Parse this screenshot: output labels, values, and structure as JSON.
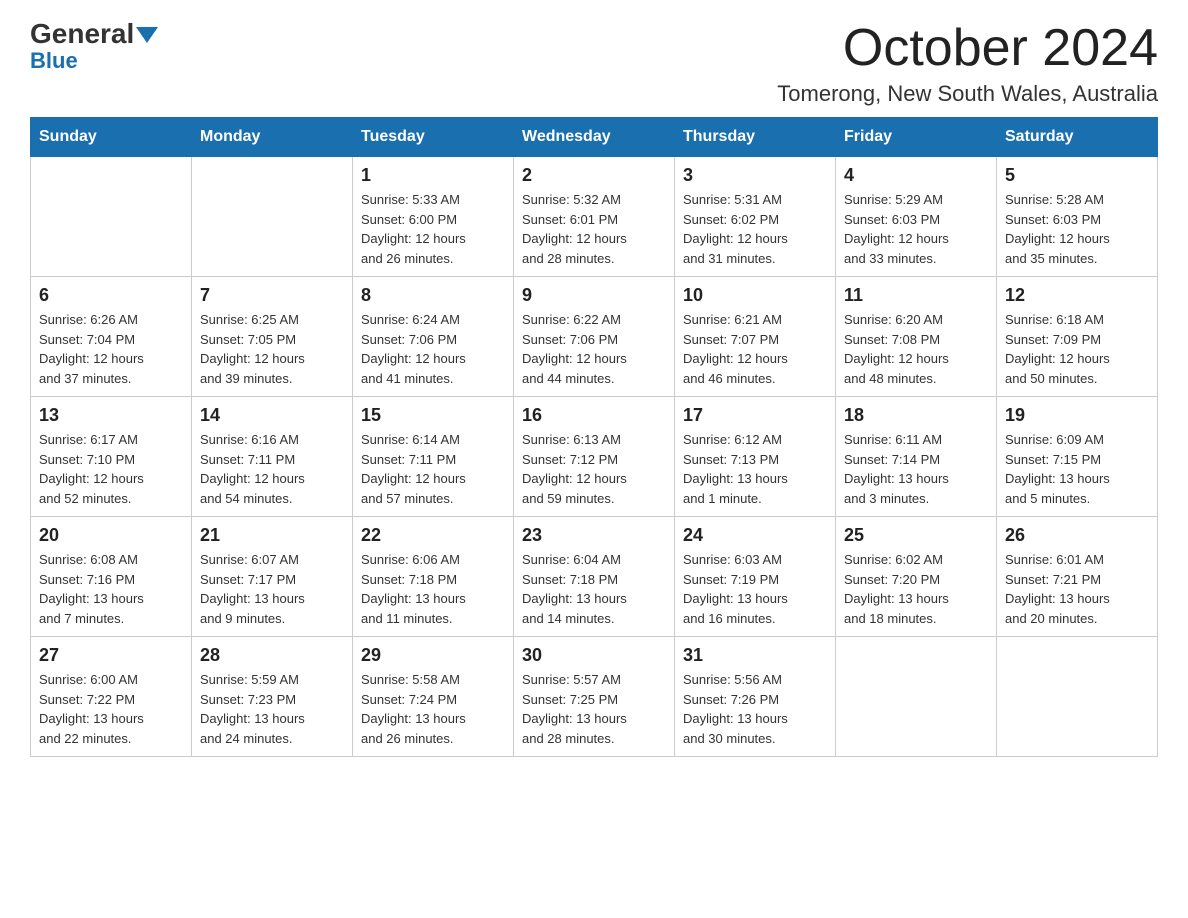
{
  "header": {
    "logo_general": "General",
    "logo_blue": "Blue",
    "title": "October 2024",
    "subtitle": "Tomerong, New South Wales, Australia"
  },
  "calendar": {
    "days_of_week": [
      "Sunday",
      "Monday",
      "Tuesday",
      "Wednesday",
      "Thursday",
      "Friday",
      "Saturday"
    ],
    "weeks": [
      [
        {
          "day": "",
          "info": ""
        },
        {
          "day": "",
          "info": ""
        },
        {
          "day": "1",
          "info": "Sunrise: 5:33 AM\nSunset: 6:00 PM\nDaylight: 12 hours\nand 26 minutes."
        },
        {
          "day": "2",
          "info": "Sunrise: 5:32 AM\nSunset: 6:01 PM\nDaylight: 12 hours\nand 28 minutes."
        },
        {
          "day": "3",
          "info": "Sunrise: 5:31 AM\nSunset: 6:02 PM\nDaylight: 12 hours\nand 31 minutes."
        },
        {
          "day": "4",
          "info": "Sunrise: 5:29 AM\nSunset: 6:03 PM\nDaylight: 12 hours\nand 33 minutes."
        },
        {
          "day": "5",
          "info": "Sunrise: 5:28 AM\nSunset: 6:03 PM\nDaylight: 12 hours\nand 35 minutes."
        }
      ],
      [
        {
          "day": "6",
          "info": "Sunrise: 6:26 AM\nSunset: 7:04 PM\nDaylight: 12 hours\nand 37 minutes."
        },
        {
          "day": "7",
          "info": "Sunrise: 6:25 AM\nSunset: 7:05 PM\nDaylight: 12 hours\nand 39 minutes."
        },
        {
          "day": "8",
          "info": "Sunrise: 6:24 AM\nSunset: 7:06 PM\nDaylight: 12 hours\nand 41 minutes."
        },
        {
          "day": "9",
          "info": "Sunrise: 6:22 AM\nSunset: 7:06 PM\nDaylight: 12 hours\nand 44 minutes."
        },
        {
          "day": "10",
          "info": "Sunrise: 6:21 AM\nSunset: 7:07 PM\nDaylight: 12 hours\nand 46 minutes."
        },
        {
          "day": "11",
          "info": "Sunrise: 6:20 AM\nSunset: 7:08 PM\nDaylight: 12 hours\nand 48 minutes."
        },
        {
          "day": "12",
          "info": "Sunrise: 6:18 AM\nSunset: 7:09 PM\nDaylight: 12 hours\nand 50 minutes."
        }
      ],
      [
        {
          "day": "13",
          "info": "Sunrise: 6:17 AM\nSunset: 7:10 PM\nDaylight: 12 hours\nand 52 minutes."
        },
        {
          "day": "14",
          "info": "Sunrise: 6:16 AM\nSunset: 7:11 PM\nDaylight: 12 hours\nand 54 minutes."
        },
        {
          "day": "15",
          "info": "Sunrise: 6:14 AM\nSunset: 7:11 PM\nDaylight: 12 hours\nand 57 minutes."
        },
        {
          "day": "16",
          "info": "Sunrise: 6:13 AM\nSunset: 7:12 PM\nDaylight: 12 hours\nand 59 minutes."
        },
        {
          "day": "17",
          "info": "Sunrise: 6:12 AM\nSunset: 7:13 PM\nDaylight: 13 hours\nand 1 minute."
        },
        {
          "day": "18",
          "info": "Sunrise: 6:11 AM\nSunset: 7:14 PM\nDaylight: 13 hours\nand 3 minutes."
        },
        {
          "day": "19",
          "info": "Sunrise: 6:09 AM\nSunset: 7:15 PM\nDaylight: 13 hours\nand 5 minutes."
        }
      ],
      [
        {
          "day": "20",
          "info": "Sunrise: 6:08 AM\nSunset: 7:16 PM\nDaylight: 13 hours\nand 7 minutes."
        },
        {
          "day": "21",
          "info": "Sunrise: 6:07 AM\nSunset: 7:17 PM\nDaylight: 13 hours\nand 9 minutes."
        },
        {
          "day": "22",
          "info": "Sunrise: 6:06 AM\nSunset: 7:18 PM\nDaylight: 13 hours\nand 11 minutes."
        },
        {
          "day": "23",
          "info": "Sunrise: 6:04 AM\nSunset: 7:18 PM\nDaylight: 13 hours\nand 14 minutes."
        },
        {
          "day": "24",
          "info": "Sunrise: 6:03 AM\nSunset: 7:19 PM\nDaylight: 13 hours\nand 16 minutes."
        },
        {
          "day": "25",
          "info": "Sunrise: 6:02 AM\nSunset: 7:20 PM\nDaylight: 13 hours\nand 18 minutes."
        },
        {
          "day": "26",
          "info": "Sunrise: 6:01 AM\nSunset: 7:21 PM\nDaylight: 13 hours\nand 20 minutes."
        }
      ],
      [
        {
          "day": "27",
          "info": "Sunrise: 6:00 AM\nSunset: 7:22 PM\nDaylight: 13 hours\nand 22 minutes."
        },
        {
          "day": "28",
          "info": "Sunrise: 5:59 AM\nSunset: 7:23 PM\nDaylight: 13 hours\nand 24 minutes."
        },
        {
          "day": "29",
          "info": "Sunrise: 5:58 AM\nSunset: 7:24 PM\nDaylight: 13 hours\nand 26 minutes."
        },
        {
          "day": "30",
          "info": "Sunrise: 5:57 AM\nSunset: 7:25 PM\nDaylight: 13 hours\nand 28 minutes."
        },
        {
          "day": "31",
          "info": "Sunrise: 5:56 AM\nSunset: 7:26 PM\nDaylight: 13 hours\nand 30 minutes."
        },
        {
          "day": "",
          "info": ""
        },
        {
          "day": "",
          "info": ""
        }
      ]
    ]
  }
}
